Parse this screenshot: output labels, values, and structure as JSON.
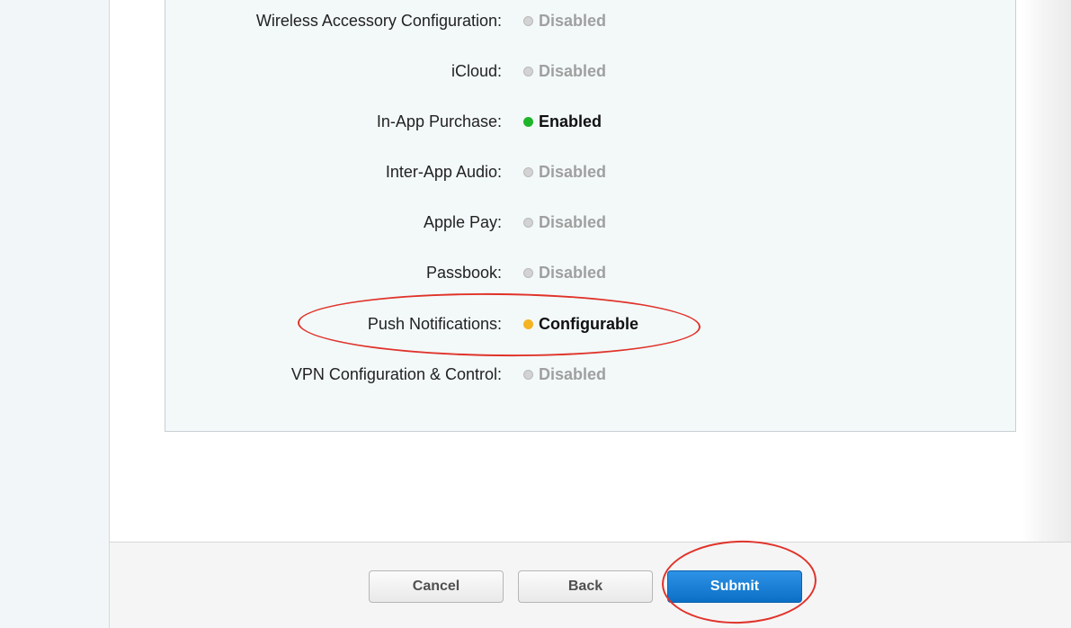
{
  "services": [
    {
      "label": "Wireless Accessory Configuration:",
      "status": "Disabled",
      "state": "disabled"
    },
    {
      "label": "iCloud:",
      "status": "Disabled",
      "state": "disabled"
    },
    {
      "label": "In-App Purchase:",
      "status": "Enabled",
      "state": "enabled"
    },
    {
      "label": "Inter-App Audio:",
      "status": "Disabled",
      "state": "disabled"
    },
    {
      "label": "Apple Pay:",
      "status": "Disabled",
      "state": "disabled"
    },
    {
      "label": "Passbook:",
      "status": "Disabled",
      "state": "disabled"
    },
    {
      "label": "Push Notifications:",
      "status": "Configurable",
      "state": "configurable"
    },
    {
      "label": "VPN Configuration & Control:",
      "status": "Disabled",
      "state": "disabled"
    }
  ],
  "footer": {
    "cancel_label": "Cancel",
    "back_label": "Back",
    "submit_label": "Submit"
  },
  "colors": {
    "enabled_dot": "#1eb52a",
    "configurable_dot": "#f4b424",
    "disabled_dot": "#d3d3d3",
    "submit_button": "#1680d8",
    "annotation_circle": "#e0332a"
  }
}
